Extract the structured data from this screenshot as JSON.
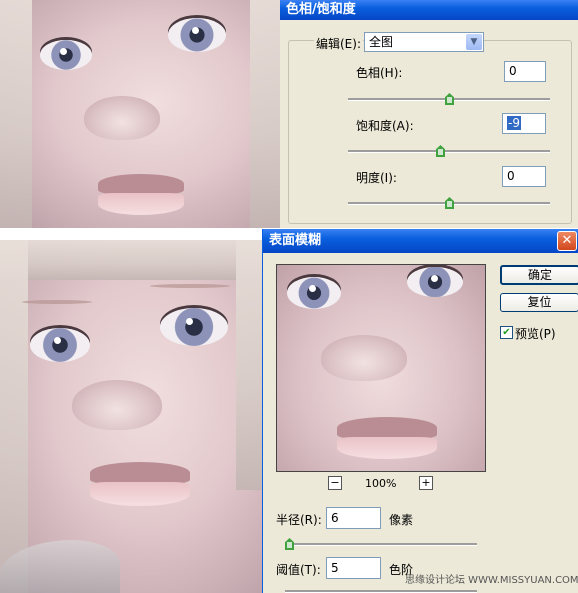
{
  "hue_sat_dialog": {
    "title": "色相/饱和度",
    "edit_label": "编辑(E):",
    "edit_value": "全图",
    "hue_label": "色相(H):",
    "hue_value": "0",
    "saturation_label": "饱和度(A):",
    "saturation_value": "-9",
    "lightness_label": "明度(I):",
    "lightness_value": "0"
  },
  "surface_blur_dialog": {
    "title": "表面模糊",
    "ok_label": "确定",
    "reset_label": "复位",
    "preview_label": "预览(P)",
    "preview_checked": true,
    "zoom_minus": "−",
    "zoom_plus": "+",
    "zoom_level": "100%",
    "radius_label": "半径(R):",
    "radius_value": "6",
    "radius_unit": "像素",
    "threshold_label": "阈值(T):",
    "threshold_value": "5",
    "threshold_unit": "色阶"
  },
  "watermark": "思缘设计论坛 WWW.MISSYUAN.COM",
  "colors": {
    "titlebar": "#0a5fde",
    "dialog_bg": "#ece9d8",
    "slider_thumb": "#3fa23f",
    "close_button": "#e0552c"
  }
}
